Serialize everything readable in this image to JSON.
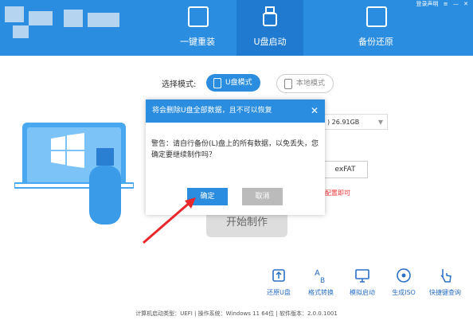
{
  "header": {
    "tabs": [
      {
        "label": "一键重装",
        "icon": "windows-install-icon"
      },
      {
        "label": "U盘启动",
        "icon": "usb-drive-icon",
        "active": true
      },
      {
        "label": "备份还原",
        "icon": "backup-restore-icon"
      }
    ],
    "top_right": [
      "登录声明",
      "≡",
      "—",
      "✕"
    ]
  },
  "mode": {
    "label": "选择模式:",
    "usb_mode": "U盘模式",
    "local_mode": "本地模式"
  },
  "drive": {
    "value": ") 26.91GB"
  },
  "fs": {
    "value": "exFAT"
  },
  "hint": {
    "text": "认配置即可"
  },
  "start_button": "开始制作",
  "tools": [
    {
      "label": "还原U盘",
      "icon": "restore-usb-icon"
    },
    {
      "label": "格式转换",
      "icon": "format-convert-icon"
    },
    {
      "label": "模拟启动",
      "icon": "simulate-boot-icon"
    },
    {
      "label": "生成ISO",
      "icon": "disc-iso-icon"
    },
    {
      "label": "快捷键查询",
      "icon": "shortcut-query-icon"
    }
  ],
  "footer": "计算机启动类型：UEFI | 操作系统：Windows 11 64位 | 软件版本：2.0.0.1001",
  "dialog": {
    "title": "将会删除U盘全部数据，且不可以恢复",
    "message": "警告：请自行备份(L)盘上的所有数据，以免丢失，您确定要继续制作吗？",
    "confirm": "确定",
    "cancel": "取消"
  },
  "colors": {
    "accent": "#2a8de0",
    "annotation_arrow": "#e8262b"
  }
}
